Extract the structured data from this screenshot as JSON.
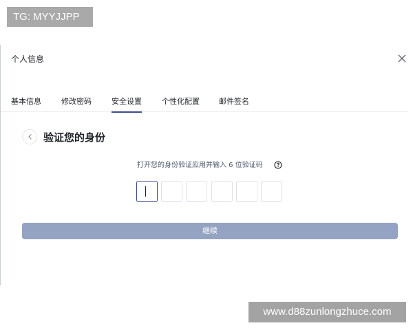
{
  "top_badge": "TG: MYYJJPP",
  "dialog": {
    "title": "个人信息",
    "tabs": [
      {
        "label": "基本信息"
      },
      {
        "label": "修改密码"
      },
      {
        "label": "安全设置",
        "active": true
      },
      {
        "label": "个性化配置"
      },
      {
        "label": "邮件签名"
      }
    ],
    "section_title": "验证您的身份",
    "instruction": "打开您的身份验证应用并输入 6 位验证码",
    "code_values": [
      "",
      "",
      "",
      "",
      "",
      ""
    ],
    "continue_label": "继续"
  },
  "watermark": "www.d88zunlongzhuce.com",
  "colors": {
    "accent": "#3b4a8c",
    "button_disabled": "#95a3c2",
    "badge_bg": "#a9a9a9"
  },
  "icons": [
    "close-icon",
    "chevron-left-icon",
    "help-circle-icon"
  ]
}
